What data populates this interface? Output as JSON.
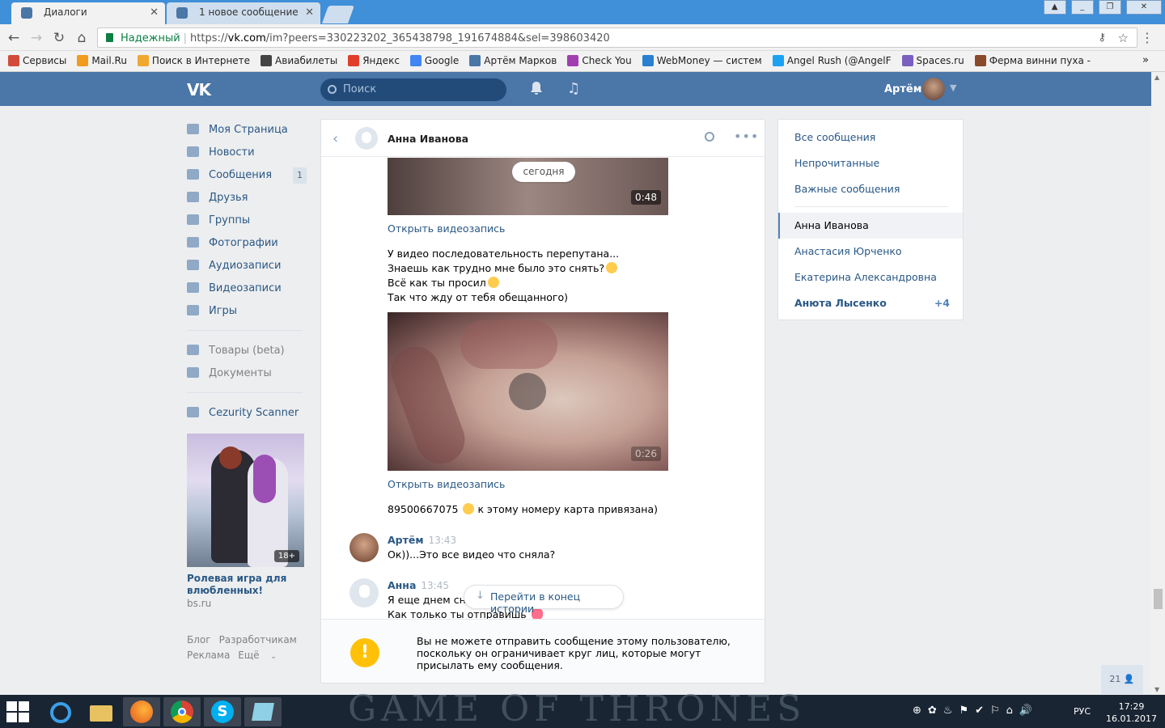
{
  "browser": {
    "tabs": [
      {
        "label": "Диалоги",
        "active": true
      },
      {
        "label": "1 новое сообщение",
        "active": false
      }
    ],
    "secure_label": "Надежный",
    "url_prefix": "https://",
    "url_host": "vk.com",
    "url_path": "/im?peers=330223202_365438798_191674884&sel=398603420",
    "bookmarks": [
      "Сервисы",
      "Mail.Ru",
      "Поиск в Интернете",
      "Авиабилеты",
      "Яндекс",
      "Google",
      "Артём Марков",
      "Check You",
      "WebMoney — систем",
      "Angel Rush (@AngelF",
      "Spaces.ru",
      "Ферма винни пуха -"
    ],
    "more_bookmarks": "»"
  },
  "vk_header": {
    "logo": "VK",
    "search_placeholder": "Поиск",
    "user_name": "Артём"
  },
  "left_menu": {
    "items": [
      {
        "label": "Моя Страница",
        "icon": "home-icon"
      },
      {
        "label": "Новости",
        "icon": "news-icon"
      },
      {
        "label": "Сообщения",
        "icon": "messages-icon",
        "badge": "1"
      },
      {
        "label": "Друзья",
        "icon": "friends-icon"
      },
      {
        "label": "Группы",
        "icon": "groups-icon"
      },
      {
        "label": "Фотографии",
        "icon": "photos-icon"
      },
      {
        "label": "Аудиозаписи",
        "icon": "audio-icon"
      },
      {
        "label": "Видеозаписи",
        "icon": "video-icon"
      },
      {
        "label": "Игры",
        "icon": "games-icon"
      }
    ],
    "items2": [
      {
        "label": "Товары (beta)",
        "icon": "goods-icon"
      },
      {
        "label": "Документы",
        "icon": "documents-icon"
      }
    ],
    "items3": [
      {
        "label": "Cezurity Scanner",
        "icon": "app-icon"
      }
    ],
    "promo": {
      "age": "18+",
      "title": "Ролевая игра для влюбленных!",
      "domain": "bs.ru"
    },
    "footer": {
      "blog": "Блог",
      "dev": "Разработчикам",
      "ads": "Реклама",
      "more": "Ещё"
    }
  },
  "chat": {
    "name": "Анна Иванова",
    "date_chip": "сегодня",
    "video1_duration": "0:48",
    "video_link": "Открыть видеозапись",
    "msg_a": [
      "У видео последовательность перепутана...",
      "Знаешь как трудно мне было это снять?",
      "Всё как ты просил",
      "Так что жду от тебя обещанного)"
    ],
    "video2_duration": "0:26",
    "msg_b_number": "89500667075",
    "msg_b_rest": "к этому номеру карта привязана)",
    "msg_c": {
      "sender": "Артём",
      "time": "13:43",
      "text": "Ок))...Это все видео что сняла?"
    },
    "msg_d": {
      "sender": "Анна",
      "time": "13:45",
      "line1": "Я еще днем сни",
      "line2": "Как только ты отправишь"
    },
    "scroll_button": "Перейти в конец истории",
    "notice": "Вы не можете отправить сообщение этому пользователю, поскольку он ограничивает круг лиц, которые могут присылать ему сообщения.",
    "notice_icon": "!"
  },
  "right_panel": {
    "filters": [
      "Все сообщения",
      "Непрочитанные",
      "Важные сообщения"
    ],
    "dialogs": [
      {
        "name": "Анна Иванова",
        "active": true
      },
      {
        "name": "Анастасия Юрченко"
      },
      {
        "name": "Екатерина Александровна"
      },
      {
        "name": "Анюта Лысенко",
        "count": "+4",
        "unread": true
      }
    ]
  },
  "online_widget": "21",
  "taskbar": {
    "lang": "РУС",
    "time": "17:29",
    "date": "16.01.2017",
    "wallpaper_text": "GAME OF THRONES"
  },
  "colors": {
    "vk_blue": "#4a76a8",
    "link": "#2a5885",
    "chrome_tab_bar": "#3f8fd9",
    "warning": "#ffc107"
  }
}
